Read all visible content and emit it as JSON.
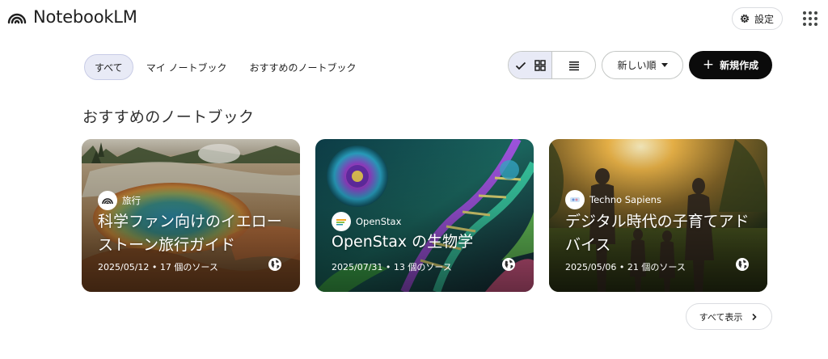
{
  "header": {
    "app_name": "NotebookLM",
    "settings_label": "設定"
  },
  "filters": {
    "chips": [
      {
        "label": "すべて",
        "active": true
      },
      {
        "label": "マイ ノートブック",
        "active": false
      },
      {
        "label": "おすすめのノートブック",
        "active": false
      }
    ]
  },
  "toolbar": {
    "view_mode": "grid",
    "sort_label": "新しい順",
    "create_label": "新規作成",
    "create_icon": "plus-icon"
  },
  "section": {
    "title": "おすすめのノートブック",
    "show_all_label": "すべて表示"
  },
  "cards": [
    {
      "source": "旅行",
      "title": "科学ファン向けのイエローストーン旅行ガイド",
      "meta": "2025/05/12 • 17 個のソース",
      "image": "hot-spring-landscape",
      "visibility_icon": "globe-icon"
    },
    {
      "source": "OpenStax",
      "title": "OpenStax の生物学",
      "meta": "2025/07/31 • 13 個のソース",
      "image": "dna-cell-illustration",
      "visibility_icon": "globe-icon"
    },
    {
      "source": "Techno Sapiens",
      "title": "デジタル時代の子育てアドバイス",
      "meta": "2025/05/06 • 21 個のソース",
      "image": "family-sunset-park",
      "visibility_icon": "globe-icon"
    }
  ],
  "colors": {
    "accent_chip": "#e8eaf6",
    "primary_button": "#0b0b0b"
  }
}
